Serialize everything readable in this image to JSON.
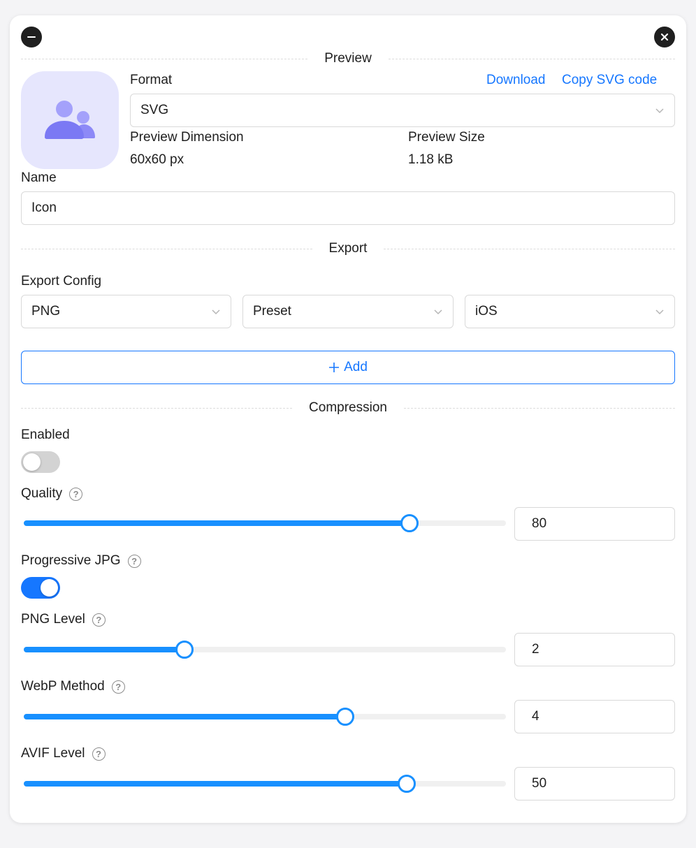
{
  "window": {
    "minimize_icon": "minus-circle-icon",
    "close_icon": "close-circle-icon"
  },
  "preview": {
    "section_title": "Preview",
    "thumbnail_icon": "users-icon",
    "format_label": "Format",
    "download_label": "Download",
    "copy_svg_label": "Copy SVG code",
    "format_value": "SVG",
    "dimension_label": "Preview Dimension",
    "dimension_value": "60x60 px",
    "size_label": "Preview Size",
    "size_value": "1.18 kB"
  },
  "name": {
    "label": "Name",
    "value": "Icon"
  },
  "export": {
    "section_title": "Export",
    "config_label": "Export Config",
    "format_value": "PNG",
    "preset_value": "Preset",
    "platform_value": "iOS",
    "add_label": "Add"
  },
  "compression": {
    "section_title": "Compression",
    "enabled_label": "Enabled",
    "enabled": false,
    "quality_label": "Quality",
    "quality_value": "80",
    "quality_fraction": 0.8,
    "progressive_label": "Progressive JPG",
    "progressive": true,
    "png_level_label": "PNG Level",
    "png_level_value": "2",
    "png_level_fraction": 0.333,
    "webp_method_label": "WebP Method",
    "webp_method_value": "4",
    "webp_method_fraction": 0.667,
    "avif_level_label": "AVIF Level",
    "avif_level_value": "50",
    "avif_level_fraction": 0.794
  },
  "colors": {
    "accent": "#1677ff",
    "slider": "#1890ff",
    "thumbnail_bg": "#e6e6fd",
    "thumbnail_icon": "#7b79f4",
    "switch_off": "#d3d3d3"
  }
}
